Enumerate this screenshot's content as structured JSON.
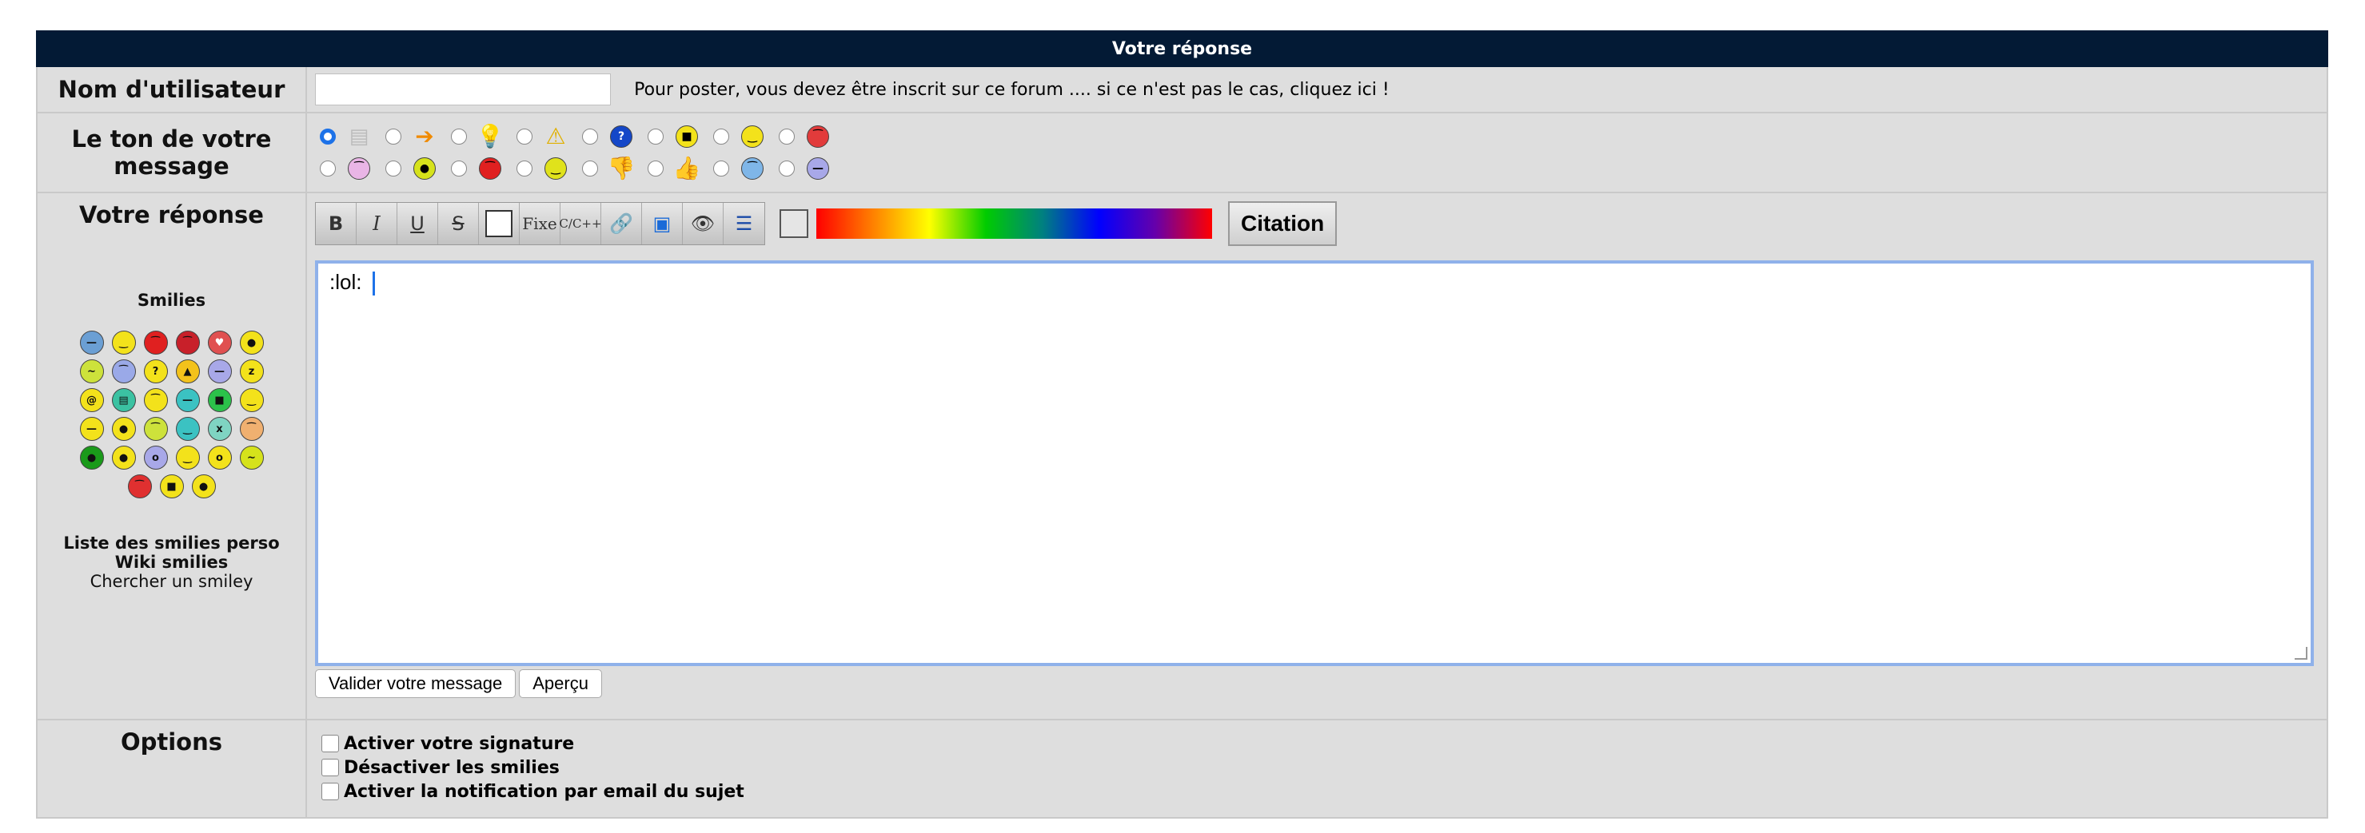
{
  "header": {
    "title": "Votre réponse"
  },
  "username": {
    "label": "Nom d'utilisateur",
    "value": "",
    "hint": "Pour poster, vous devez être inscrit sur ce forum .... si ce n'est pas le cas, cliquez ici !"
  },
  "tone": {
    "label": "Le ton de votre message",
    "selected_index": 0,
    "icons": [
      "document-icon",
      "arrow-icon",
      "lightbulb-icon",
      "warning-icon",
      "question-icon",
      "sunglasses-smiley-icon",
      "smile-smiley-icon",
      "angry-smiley-icon",
      "sad-smiley-icon",
      "grin-smiley-icon",
      "mad-red-smiley-icon",
      "wink-smiley-icon",
      "thumbs-down-icon",
      "thumbs-up-icon",
      "crying-smiley-icon",
      "sleepy-smiley-icon"
    ]
  },
  "reply": {
    "label": "Votre réponse",
    "toolbar": {
      "bold": "B",
      "italic": "I",
      "underline": "U",
      "strike": "S",
      "fixed": "Fixe",
      "code": "C/C++",
      "citation": "Citation"
    },
    "textarea_value": ":lol: ",
    "submit": "Valider votre message",
    "preview": "Aperçu"
  },
  "smilies": {
    "title": "Smilies",
    "icons": [
      "sleepy",
      "smile",
      "mad",
      "angry",
      "love",
      "grin",
      "confused",
      "sad",
      "question",
      "hat",
      "drool",
      "zzz",
      "dizzy",
      "toothy",
      "worried",
      "sick",
      "cool-green",
      "happy",
      "eh",
      "sweat",
      "crazy",
      "cyan",
      "fish",
      "orange",
      "frog",
      "wink",
      "dizzy2",
      "fear",
      "shock",
      "confused2",
      "yuck",
      "sunglasses",
      "skeleton"
    ],
    "links": {
      "list": "Liste des smilies perso",
      "wiki": "Wiki smilies",
      "search": "Chercher un smiley"
    }
  },
  "options": {
    "label": "Options",
    "items": [
      "Activer votre signature",
      "Désactiver les smilies",
      "Activer la notification par email du sujet"
    ]
  },
  "colors": {
    "header_bg": "#031a35",
    "panel_bg": "#dedede",
    "accent": "#1d72e8"
  }
}
